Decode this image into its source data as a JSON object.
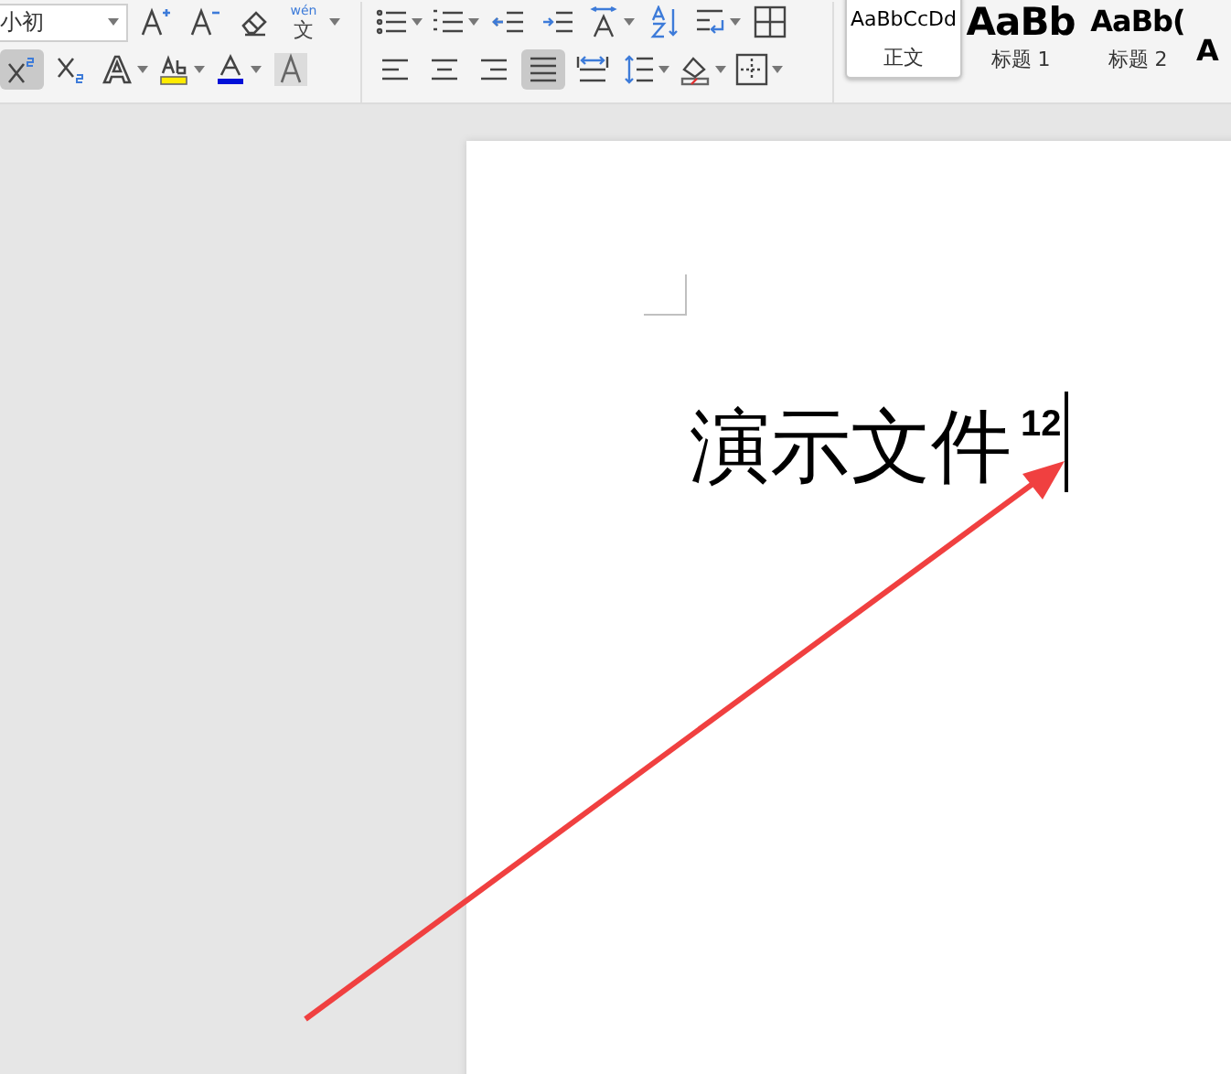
{
  "font_group": {
    "font_size": {
      "value": "小初"
    },
    "row_1": [
      {
        "kind": "grow-font",
        "selected": false,
        "has_menu": false
      },
      {
        "kind": "shrink-font",
        "selected": false,
        "has_menu": false
      },
      {
        "kind": "eraser",
        "selected": false,
        "has_menu": false
      }
    ],
    "phonetic_guide": {
      "pinyin": "wén",
      "character": "文",
      "has_menu": true
    },
    "row_2": [
      {
        "kind": "superscript",
        "selected": true,
        "has_menu": false
      },
      {
        "kind": "subscript",
        "selected": false,
        "has_menu": false
      },
      {
        "kind": "text-effect",
        "selected": false,
        "has_menu": true
      },
      {
        "kind": "highlight",
        "selected": false,
        "has_menu": true
      },
      {
        "kind": "font-color",
        "selected": false,
        "has_menu": true
      },
      {
        "kind": "char-shading",
        "selected": false,
        "has_menu": false
      }
    ]
  },
  "paragraph_group": {
    "row_1": [
      {
        "kind": "bullets",
        "selected": false,
        "has_menu": true
      },
      {
        "kind": "numbering",
        "selected": false,
        "has_menu": true
      },
      {
        "kind": "outdent",
        "selected": false,
        "has_menu": false
      },
      {
        "kind": "indent",
        "selected": false,
        "has_menu": false
      },
      {
        "kind": "text-direction",
        "selected": false,
        "has_menu": true
      },
      {
        "kind": "sort",
        "selected": false,
        "has_menu": false
      },
      {
        "kind": "line-break",
        "selected": false,
        "has_menu": true
      },
      {
        "kind": "table",
        "selected": false,
        "has_menu": false
      }
    ],
    "row_2": [
      {
        "kind": "align-left",
        "selected": false,
        "has_menu": false
      },
      {
        "kind": "align-center",
        "selected": false,
        "has_menu": false
      },
      {
        "kind": "align-right",
        "selected": false,
        "has_menu": false
      },
      {
        "kind": "justify",
        "selected": true,
        "has_menu": false
      },
      {
        "kind": "distribute",
        "selected": false,
        "has_menu": false
      },
      {
        "kind": "line-spacing",
        "selected": false,
        "has_menu": true
      },
      {
        "kind": "shading",
        "selected": false,
        "has_menu": true
      },
      {
        "kind": "borders",
        "selected": false,
        "has_menu": true
      }
    ]
  },
  "styles": [
    {
      "preview": "AaBbCcDd",
      "label": "正文",
      "kind": "body",
      "selected": true
    },
    {
      "preview": "AaBb",
      "label": "标题 1",
      "kind": "heading1",
      "selected": false
    },
    {
      "preview": "AaBb(",
      "label": "标题 2",
      "kind": "heading2",
      "selected": false
    },
    {
      "preview": "A",
      "kind": "heading3",
      "selected": false
    }
  ],
  "document": {
    "heading": "演示文件",
    "superscript": "12"
  }
}
